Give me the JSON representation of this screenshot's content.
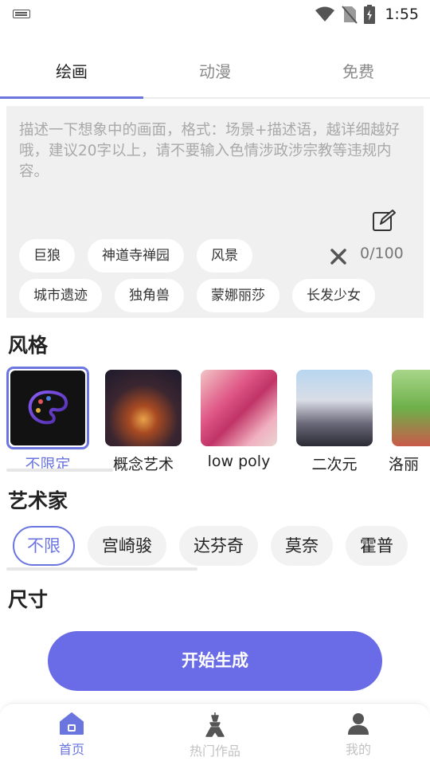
{
  "status_bar": {
    "time": "1:55"
  },
  "tabs": [
    {
      "label": "绘画",
      "active": true
    },
    {
      "label": "动漫",
      "active": false
    },
    {
      "label": "免费",
      "active": false
    }
  ],
  "prompt": {
    "placeholder": "描述一下想象中的画面，格式：场景+描述语，越详细越好哦，建议20字以上，请不要输入色情涉政涉宗教等违规内容。",
    "counter": "0/100",
    "chips_row1": [
      "巨狼",
      "神道寺禅园",
      "风景"
    ],
    "chips_row2": [
      "城市遗迹",
      "独角兽",
      "蒙娜丽莎",
      "长发少女"
    ]
  },
  "styles_section": {
    "title": "风格",
    "items": [
      {
        "label": "不限定",
        "selected": true
      },
      {
        "label": "概念艺术",
        "selected": false
      },
      {
        "label": "low poly",
        "selected": false
      },
      {
        "label": "二次元",
        "selected": false
      },
      {
        "label": "洛丽",
        "selected": false
      }
    ]
  },
  "artist_section": {
    "title": "艺术家",
    "items": [
      "不限",
      "宫崎骏",
      "达芬奇",
      "莫奈",
      "霍普"
    ],
    "selected_index": 0
  },
  "size_section": {
    "title": "尺寸"
  },
  "generate_button": {
    "label": "开始生成"
  },
  "bottom_nav": [
    {
      "label": "首页",
      "active": true,
      "icon": "home-icon"
    },
    {
      "label": "热门作品",
      "active": false,
      "icon": "tower-icon"
    },
    {
      "label": "我的",
      "active": false,
      "icon": "person-icon"
    }
  ],
  "colors": {
    "accent": "#6b75e0",
    "button": "#6a6be6",
    "prompt_bg": "#f0f0f0"
  }
}
